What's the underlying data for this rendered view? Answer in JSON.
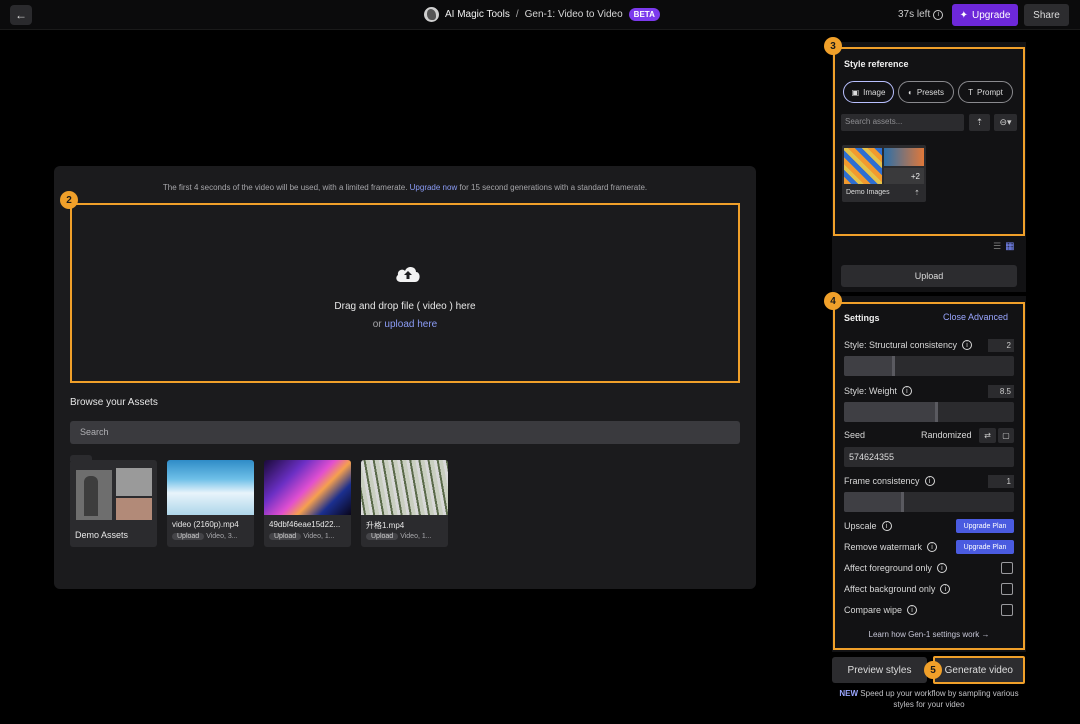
{
  "topbar": {
    "back_icon": "arrow-left-icon",
    "app_name": "AI Magic Tools",
    "separator": "/",
    "page_name": "Gen-1: Video to Video",
    "beta_label": "BETA",
    "time_left": "37s left",
    "upgrade_label": "Upgrade",
    "share_label": "Share",
    "accent": "#6d28d9"
  },
  "main": {
    "notice_prefix": "The first 4 seconds of the video will be used, with a limited framerate. ",
    "notice_link": "Upgrade now",
    "notice_suffix": " for 15 second generations with a standard framerate.",
    "drop_text": "Drag and drop file ( video ) here",
    "drop_or": "or ",
    "drop_link": "upload here",
    "browse_title": "Browse your Assets",
    "search_placeholder": "Search",
    "folder_name": "Demo Assets",
    "assets": [
      {
        "name": "video (2160p).mp4",
        "tag": "Upload",
        "meta": "Video, 3..."
      },
      {
        "name": "49dbf46eae15d22...",
        "tag": "Upload",
        "meta": "Video, 1..."
      },
      {
        "name": "升格1.mp4",
        "tag": "Upload",
        "meta": "Video, 1..."
      }
    ]
  },
  "badges": [
    "2",
    "3",
    "4",
    "5"
  ],
  "style_reference": {
    "title": "Style reference",
    "tabs": [
      "Image",
      "Presets",
      "Prompt"
    ],
    "search_placeholder": "Search assets...",
    "demo_name": "Demo Images",
    "demo_extra": "+2",
    "upload_label": "Upload"
  },
  "settings": {
    "title": "Settings",
    "close_advanced": "Close Advanced",
    "structural_label": "Style: Structural consistency",
    "structural_value": "2",
    "structural_fill": 0.3,
    "weight_label": "Style: Weight",
    "weight_value": "8.5",
    "weight_fill": 0.55,
    "seed_label": "Seed",
    "randomized_label": "Randomized",
    "seed_value": "574624355",
    "frame_label": "Frame consistency",
    "frame_value": "1",
    "frame_fill": 0.35,
    "upscale_label": "Upscale",
    "watermark_label": "Remove watermark",
    "upgrade_plan": "Upgrade Plan",
    "fg_label": "Affect foreground only",
    "bg_label": "Affect background only",
    "wipe_label": "Compare wipe",
    "learn_label": "Learn how Gen-1 settings work →"
  },
  "footer": {
    "preview_label": "Preview styles",
    "generate_label": "Generate video",
    "new_tag": "NEW",
    "new_text": " Speed up your workflow by sampling various styles for your video"
  }
}
